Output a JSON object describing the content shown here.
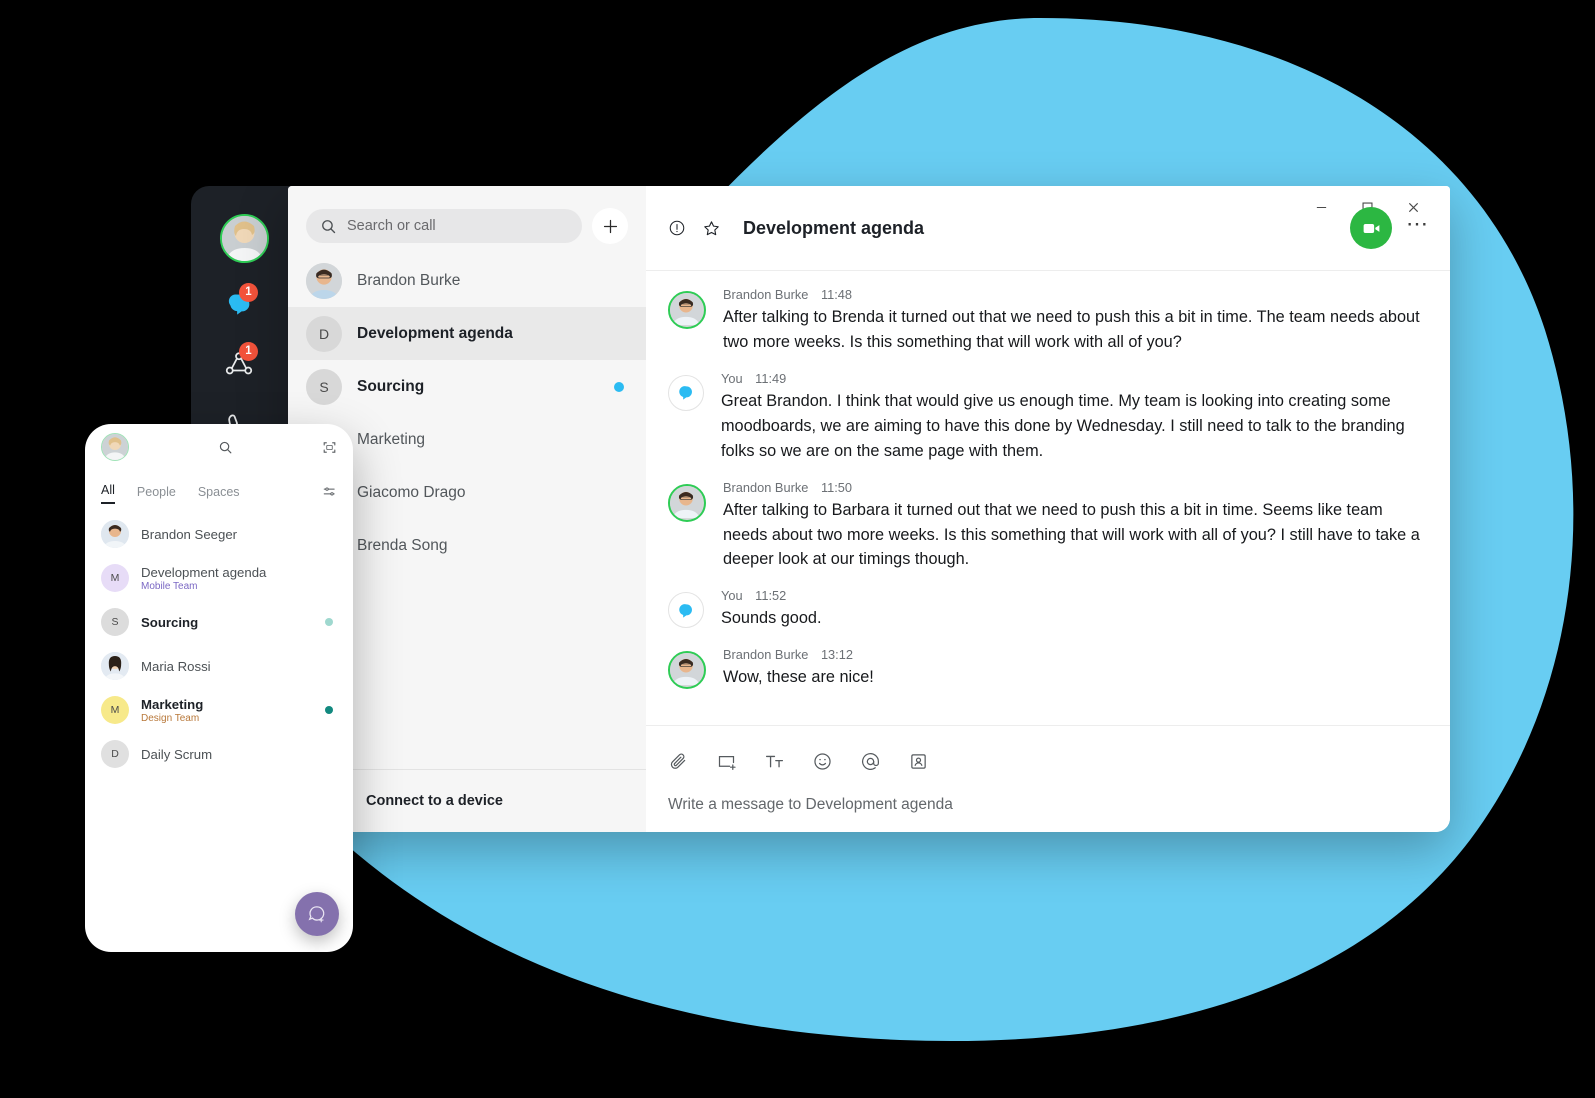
{
  "theme": {
    "blob_color": "#68cdf2",
    "rail_bg": "#1d2127",
    "accent_green": "#2cb742",
    "accent_blue": "#2bbbf2",
    "badge_red": "#f4533b",
    "fab_purple": "#8471ad"
  },
  "rail": {
    "avatar_name": "user-avatar",
    "items": [
      {
        "icon": "chat-bubble-icon",
        "badge": "1"
      },
      {
        "icon": "spaces-icon",
        "badge": "1"
      },
      {
        "icon": "phone-icon",
        "badge": ""
      }
    ]
  },
  "sidebar": {
    "search": {
      "placeholder": "Search or call",
      "value": ""
    },
    "new_button_label": "+",
    "conversations": [
      {
        "name": "Brandon Burke",
        "initial": "",
        "style": "normal",
        "selected": false,
        "unread": false,
        "photo": true
      },
      {
        "name": "Development agenda",
        "initial": "D",
        "style": "semibold",
        "selected": true,
        "unread": false,
        "photo": false
      },
      {
        "name": "Sourcing",
        "initial": "S",
        "style": "bold",
        "selected": false,
        "unread": true,
        "photo": false
      },
      {
        "name": "Marketing",
        "initial": "",
        "style": "normal",
        "selected": false,
        "unread": false,
        "photo": false
      },
      {
        "name": "Giacomo Drago",
        "initial": "",
        "style": "normal",
        "selected": false,
        "unread": false,
        "photo": false
      },
      {
        "name": "Brenda Song",
        "initial": "",
        "style": "normal",
        "selected": false,
        "unread": false,
        "photo": false
      }
    ],
    "connect": {
      "label": "Connect to a device",
      "icon": "cast-icon"
    }
  },
  "window_controls": {
    "minimize": "—",
    "maximize": "☐",
    "close": "✕"
  },
  "chat": {
    "info_icon": "info-icon",
    "favorite_icon": "star-icon",
    "title": "Development agenda",
    "call_button": "video-call-icon",
    "more_button": "more-options-icon",
    "messages": [
      {
        "author": "Brandon Burke",
        "time": "11:48",
        "self": false,
        "text": "After talking to Brenda it turned out that we need to push this a bit in time. The team needs about two more weeks. Is this something that will work with all of you?"
      },
      {
        "author": "You",
        "time": "11:49",
        "self": true,
        "text": "Great Brandon. I think that would give us enough time. My team is looking into creating some moodboards, we are aiming to have this done by Wednesday. I still need to talk to the branding folks so we are on the same page with them."
      },
      {
        "author": "Brandon Burke",
        "time": "11:50",
        "self": false,
        "text": "After talking to Barbara it turned out that we need to push this a bit in time. Seems like team needs about two more weeks. Is this something that will work with all of you? I still have to take a deeper look at our timings though."
      },
      {
        "author": "You",
        "time": "11:52",
        "self": true,
        "text": "Sounds good."
      },
      {
        "author": "Brandon Burke",
        "time": "13:12",
        "self": false,
        "text": "Wow, these are nice!"
      }
    ],
    "composer": {
      "icons": [
        "attach-icon",
        "screen-share-icon",
        "text-format-icon",
        "emoji-icon",
        "mention-icon",
        "contact-card-icon"
      ],
      "placeholder": "Write a message to Development agenda"
    }
  },
  "phone": {
    "header": {
      "avatar": "user-avatar",
      "search_icon": "search-icon",
      "scan_icon": "scan-icon"
    },
    "tabs": [
      {
        "label": "All",
        "active": true
      },
      {
        "label": "People",
        "active": false
      },
      {
        "label": "Spaces",
        "active": false
      }
    ],
    "filter_icon": "filter-icon",
    "rows": [
      {
        "name": "Brandon Seeger",
        "initial": "",
        "sub": "",
        "sub_color": "",
        "avatar_bg": "#e7eef5",
        "bold": false,
        "photo": true,
        "dot": ""
      },
      {
        "name": "Development agenda",
        "initial": "M",
        "sub": "Mobile Team",
        "sub_color": "#7b68c4",
        "avatar_bg": "#e7dcf7",
        "bold": false,
        "photo": false,
        "dot": ""
      },
      {
        "name": "Sourcing",
        "initial": "S",
        "sub": "",
        "sub_color": "",
        "avatar_bg": "#dcdcdc",
        "bold": true,
        "photo": false,
        "dot": "#9fd8cf"
      },
      {
        "name": "Maria Rossi",
        "initial": "",
        "sub": "",
        "sub_color": "",
        "avatar_bg": "#e3eaf2",
        "bold": false,
        "photo": true,
        "dot": ""
      },
      {
        "name": "Marketing",
        "initial": "M",
        "sub": "Design Team",
        "sub_color": "#b8783a",
        "avatar_bg": "#f7e98a",
        "bold": true,
        "photo": false,
        "dot": "#12897f"
      },
      {
        "name": "Daily Scrum",
        "initial": "D",
        "sub": "",
        "sub_color": "",
        "avatar_bg": "#e0e0e0",
        "bold": false,
        "photo": false,
        "dot": ""
      }
    ],
    "fab": {
      "icon": "new-chat-icon"
    }
  }
}
